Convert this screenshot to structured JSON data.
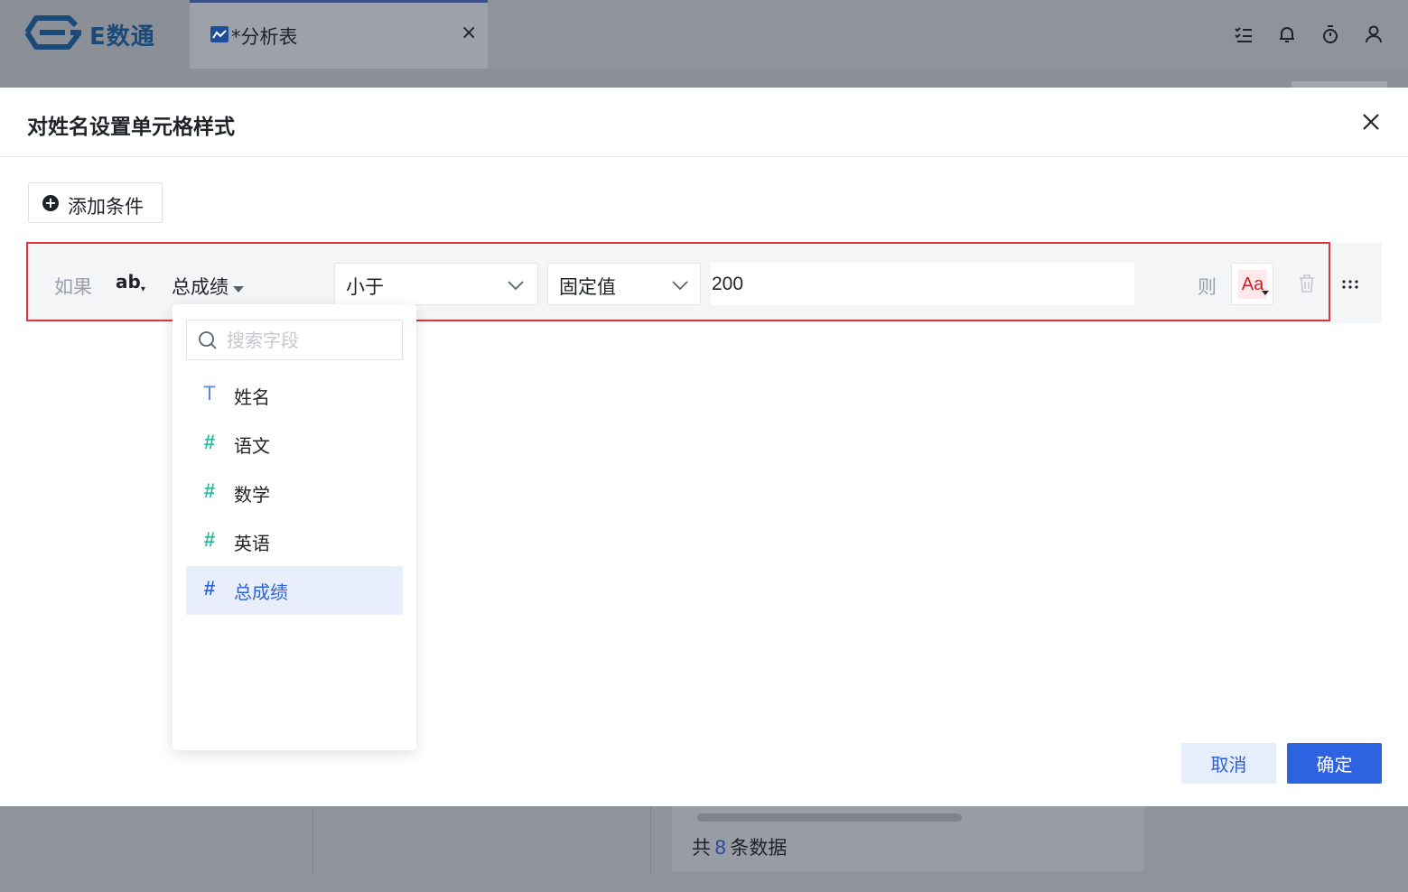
{
  "app": {
    "logo_text": "E数通"
  },
  "tab": {
    "label": "*分析表",
    "close": "×"
  },
  "top_icons": [
    "list-check-icon",
    "bell-icon",
    "timer-icon",
    "user-icon"
  ],
  "dialog": {
    "title": "对姓名设置单元格样式",
    "add_condition": "添加条件",
    "condition": {
      "if_label": "如果",
      "field_type_icon": "ab",
      "field": "总成绩",
      "operator": "小于",
      "value_type": "固定值",
      "value": "200",
      "then_label": "则",
      "style_preview": "Aa"
    },
    "dropdown": {
      "search_placeholder": "搜索字段",
      "fields": [
        {
          "name": "姓名",
          "type": "text",
          "icon": "T"
        },
        {
          "name": "语文",
          "type": "number",
          "icon": "#"
        },
        {
          "name": "数学",
          "type": "number",
          "icon": "#"
        },
        {
          "name": "英语",
          "type": "number",
          "icon": "#"
        },
        {
          "name": "总成绩",
          "type": "number",
          "icon": "#",
          "selected": true
        }
      ]
    },
    "cancel": "取消",
    "confirm": "确定"
  },
  "footer": {
    "prefix": "共",
    "count": "8",
    "suffix": "条数据"
  },
  "colors": {
    "accent": "#2d62e0",
    "highlight_border": "#e0343c",
    "number_icon": "#2ab79a"
  }
}
